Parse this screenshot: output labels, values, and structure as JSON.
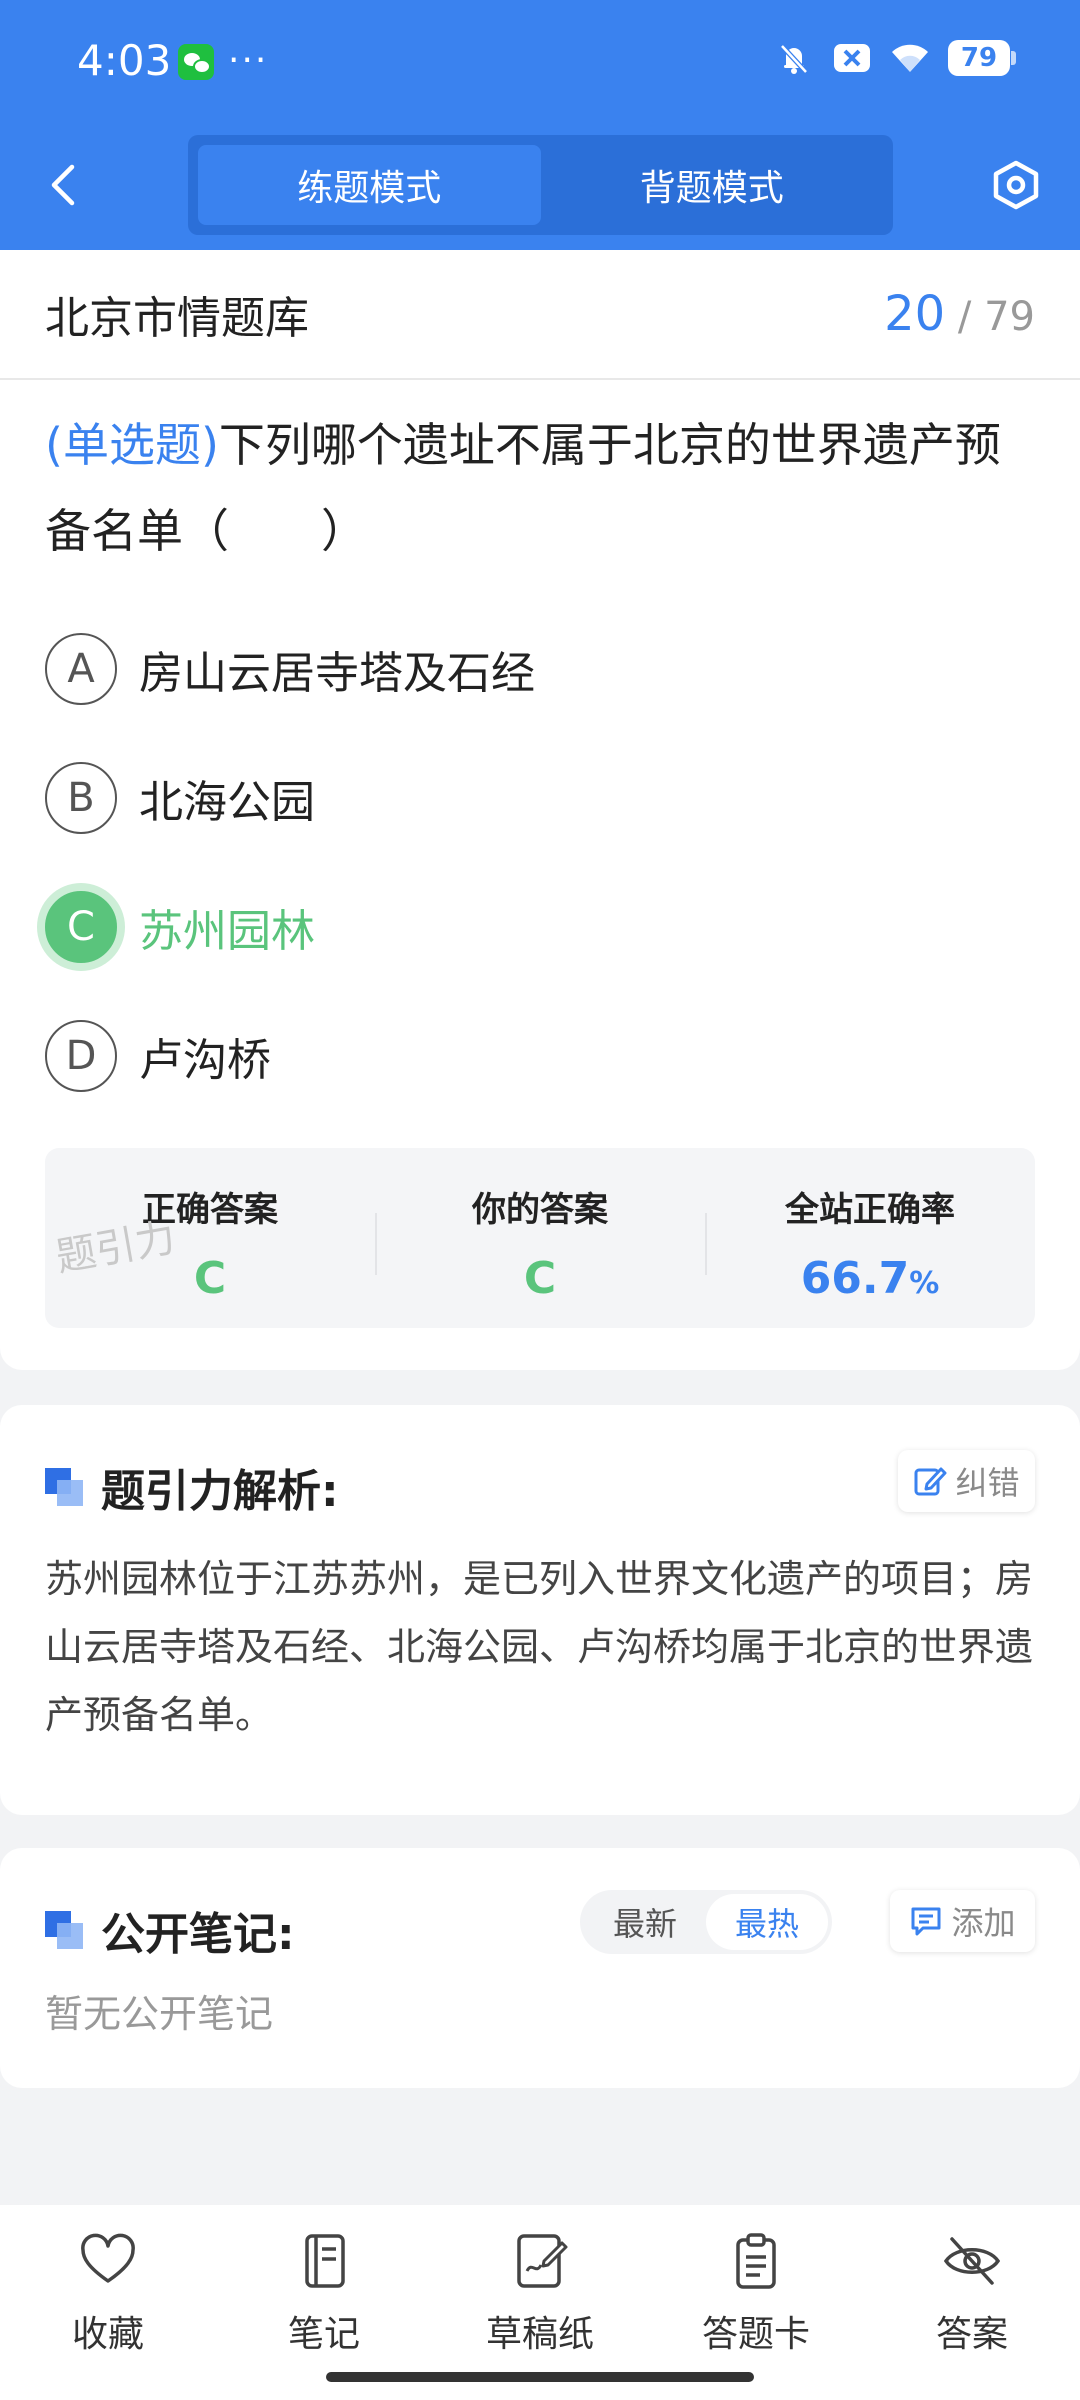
{
  "status_bar": {
    "time": "4:03",
    "dots": "···",
    "battery": "79"
  },
  "header": {
    "tabs": [
      {
        "label": "练题模式",
        "active": true
      },
      {
        "label": "背题模式",
        "active": false
      }
    ]
  },
  "bank": {
    "title": "北京市情题库",
    "current": "20",
    "separator": "/",
    "total": "79"
  },
  "question": {
    "type": "(单选题)",
    "text": "下列哪个遗址不属于北京的世界遗产预备名单（　　）"
  },
  "options": [
    {
      "letter": "A",
      "text": "房山云居寺塔及石经",
      "state": "normal"
    },
    {
      "letter": "B",
      "text": "北海公园",
      "state": "normal"
    },
    {
      "letter": "C",
      "text": "苏州园林",
      "state": "correct"
    },
    {
      "letter": "D",
      "text": "卢沟桥",
      "state": "normal"
    }
  ],
  "stats": {
    "correct_label": "正确答案",
    "correct_value": "C",
    "yours_label": "你的答案",
    "yours_value": "C",
    "rate_label": "全站正确率",
    "rate_value": "66.7",
    "rate_unit": "%"
  },
  "watermark": "题引力",
  "analysis": {
    "title": "题引力解析:",
    "report_label": "纠错",
    "text": "苏州园林位于江苏苏州，是已列入世界文化遗产的项目；房山云居寺塔及石经、北海公园、卢沟桥均属于北京的世界遗产预备名单。"
  },
  "notes": {
    "title": "公开笔记:",
    "sort_latest": "最新",
    "sort_hot": "最热",
    "add_label": "添加",
    "empty": "暂无公开笔记"
  },
  "bottom_bar": [
    {
      "label": "收藏",
      "icon": "heart-icon"
    },
    {
      "label": "笔记",
      "icon": "notebook-icon"
    },
    {
      "label": "草稿纸",
      "icon": "draft-icon"
    },
    {
      "label": "答题卡",
      "icon": "clipboard-icon"
    },
    {
      "label": "答案",
      "icon": "eye-off-icon"
    }
  ],
  "colors": {
    "primary": "#3a82ef",
    "correct": "#5ac47c"
  }
}
